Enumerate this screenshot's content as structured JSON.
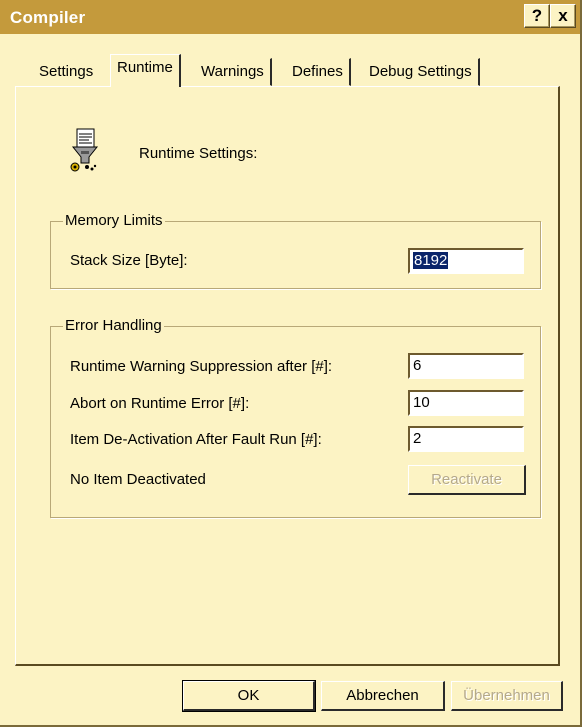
{
  "window": {
    "title": "Compiler",
    "help_button": "?",
    "close_button": "x"
  },
  "tabs": [
    {
      "label": "Settings"
    },
    {
      "label": "Runtime"
    },
    {
      "label": "Warnings"
    },
    {
      "label": "Defines"
    },
    {
      "label": "Debug Settings"
    }
  ],
  "active_tab": "Runtime",
  "header": {
    "icon": "compiler-gear-icon",
    "text": "Runtime Settings:"
  },
  "memory_limits": {
    "title": "Memory Limits",
    "stack_size_label": "Stack Size [Byte]:",
    "stack_size_value": "8192"
  },
  "error_handling": {
    "title": "Error Handling",
    "warning_suppression_label": "Runtime Warning Suppression after [#]:",
    "warning_suppression_value": "6",
    "abort_label": "Abort on Runtime Error [#]:",
    "abort_value": "10",
    "deactivation_label": "Item De-Activation After Fault Run [#]:",
    "deactivation_value": "2",
    "status_text": "No Item Deactivated",
    "reactivate_label": "Reactivate"
  },
  "footer": {
    "ok_label": "OK",
    "cancel_label": "Abbrechen",
    "apply_label": "Übernehmen"
  },
  "colors": {
    "background": "#fcf3c4",
    "titlebar": "#c49a3c",
    "selection": "#0a246a"
  }
}
